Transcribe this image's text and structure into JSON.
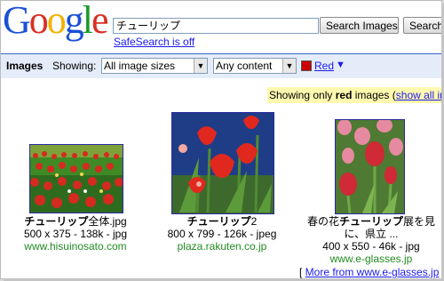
{
  "logo": {
    "text": "Google"
  },
  "search": {
    "query": "チューリップ",
    "search_images_label": "Search Images",
    "search_web_label": "Search"
  },
  "safesearch": {
    "label": "SafeSearch is off"
  },
  "filterbar": {
    "title": "Images",
    "showing_label": "Showing:",
    "size_select": "All image sizes",
    "content_select": "Any content",
    "color_label": "Red",
    "color_swatch": "#cc0000",
    "arrow": "▼"
  },
  "notice": {
    "prefix": "Showing only ",
    "color_word": "red",
    "suffix": " images (",
    "link": "show all im"
  },
  "results": [
    {
      "title_bold": "チューリップ",
      "title_rest": "全体.jpg",
      "meta": "500 x 375 - 138k - jpg",
      "url": "www.hisuinosato.com"
    },
    {
      "title_bold": "チューリップ",
      "title_rest": "2",
      "meta": "800 x 799 - 126k - jpeg",
      "url": "plaza.rakuten.co.jp"
    },
    {
      "title_pre": "春の花",
      "title_bold": "チューリップ",
      "title_rest": "展を見",
      "title_line2": "に、県立 ...",
      "meta": "400 x 550 - 46k - jpg",
      "url": "www.e-glasses.jp"
    }
  ],
  "more_from": {
    "open": "[ ",
    "link": "More from www.e-glasses.jp",
    "close": " ]"
  }
}
